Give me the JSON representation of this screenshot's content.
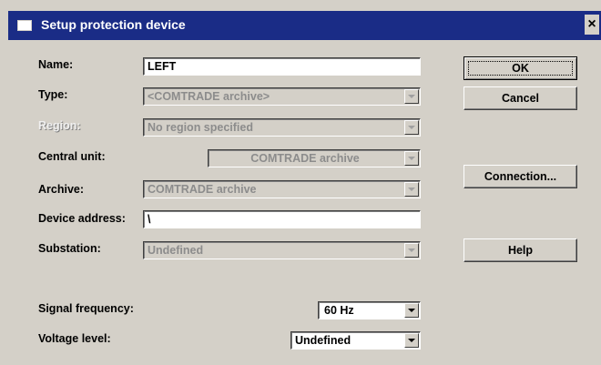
{
  "window": {
    "title": "Setup protection device",
    "close_label": "×"
  },
  "form": {
    "name": {
      "label": "Name:",
      "value": "LEFT"
    },
    "type": {
      "label": "Type:",
      "value": "<COMTRADE archive>"
    },
    "region": {
      "label": "Region:",
      "value": "No region specified"
    },
    "central_unit": {
      "label": "Central unit:",
      "value": "COMTRADE archive"
    },
    "archive": {
      "label": "Archive:",
      "value": "COMTRADE archive"
    },
    "device_address": {
      "label": "Device address:",
      "value": "\\"
    },
    "substation": {
      "label": "Substation:",
      "value": "Undefined"
    },
    "signal_frequency": {
      "label": "Signal frequency:",
      "value": "60 Hz"
    },
    "voltage_level": {
      "label": "Voltage level:",
      "value": "Undefined"
    }
  },
  "buttons": {
    "ok": "OK",
    "cancel": "Cancel",
    "connection": "Connection...",
    "help": "Help"
  },
  "colors": {
    "titlebar": "#1a2c86",
    "dialog_bg": "#d4d0c8",
    "disabled_text": "#8c8c8c"
  }
}
